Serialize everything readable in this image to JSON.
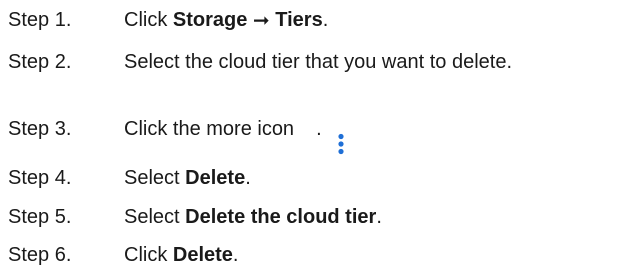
{
  "steps": [
    {
      "num": "Step 1.",
      "t1": "Click ",
      "b1": "Storage",
      "t2": " ",
      "arrow": "➞",
      "t3": " ",
      "b2": "Tiers",
      "t4": "."
    },
    {
      "num": "Step 2.",
      "t1": "Select the cloud tier that you want to delete."
    },
    {
      "num": "Step 3.",
      "t1": "Click the more icon",
      "icon": "vertical-ellipsis-icon",
      "t2": "."
    },
    {
      "num": "Step 4.",
      "t1": "Select ",
      "b1": "Delete",
      "t2": "."
    },
    {
      "num": "Step 5.",
      "t1": "Select ",
      "b1": "Delete the cloud tier",
      "t2": "."
    },
    {
      "num": "Step 6.",
      "t1": "Click ",
      "b1": "Delete",
      "t2": "."
    }
  ],
  "colors": {
    "text": "#1a1a1a",
    "icon": "#1f6fd6"
  }
}
